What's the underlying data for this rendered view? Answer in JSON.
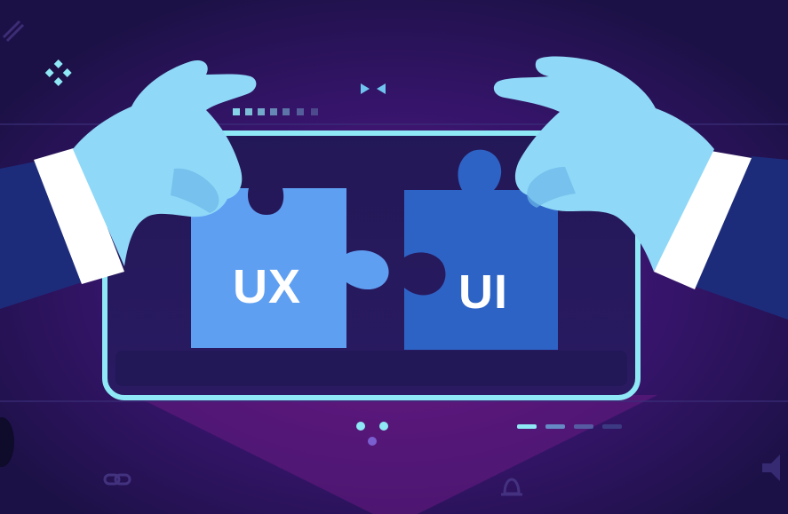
{
  "illustration": {
    "ux_piece": {
      "label": "UX",
      "color": "#5f9ff2"
    },
    "ui_piece": {
      "label": "UI",
      "color": "#2e63c6"
    },
    "colors": {
      "background": "#1c1147",
      "accent_magenta": "#7a1d88",
      "screen_frame": "#8fe8f5",
      "hand": "#8fd8f8",
      "sleeve": "#1d2c7a",
      "cuff": "#ffffff"
    },
    "icons": [
      "pencil-icon",
      "sparkle-icon",
      "bowtie-icon",
      "link-icon",
      "bell-icon",
      "speaker-icon",
      "pill-icon"
    ]
  }
}
